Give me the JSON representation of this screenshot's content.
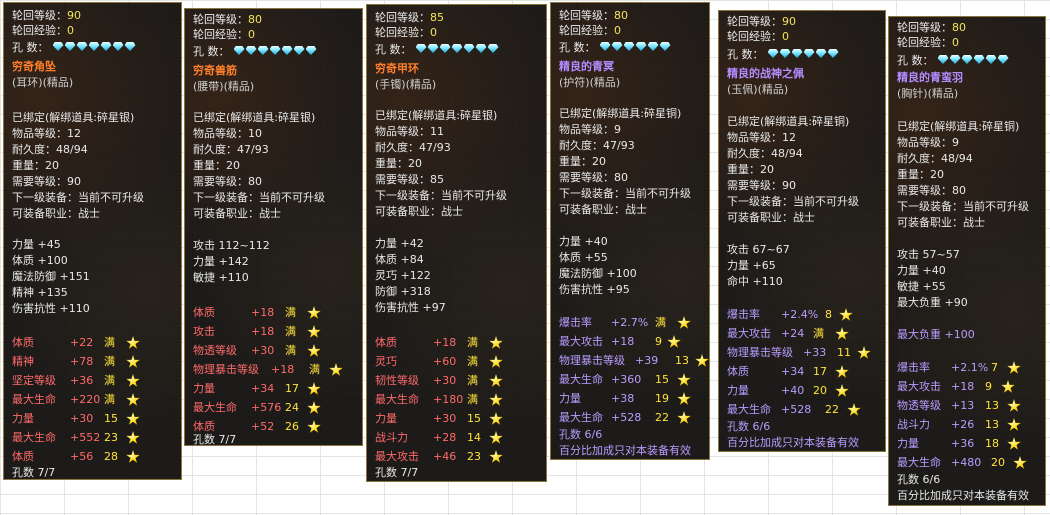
{
  "panels": [
    {
      "header": [
        {
          "label": "轮回等级：",
          "value": "90"
        },
        {
          "label": "轮回经验：",
          "value": "0"
        }
      ],
      "holes_label": "孔    数：",
      "gem_count": 7,
      "name": "穷奇角坠",
      "name_color": "#ff7f2a",
      "type": "(耳环)(精品)",
      "info": [
        "已绑定(解绑道具:碎星银)",
        "物品等级：12",
        "耐久度：48/94",
        "重量：20",
        "需要等级：90",
        "下一级装备：当前不可升级",
        "可装备职业：战士"
      ],
      "base_stats": [
        "力量 +45",
        "体质 +100",
        "魔法防御 +151",
        "精神 +135",
        "伤害抗性 +110"
      ],
      "extra_stats": [
        {
          "name": "体质",
          "value": "+22",
          "full": "满"
        },
        {
          "name": "精神",
          "value": "+78",
          "full": "满"
        },
        {
          "name": "坚定等级",
          "value": "+36",
          "full": "满"
        },
        {
          "name": "最大生命",
          "value": "+220",
          "full": "满"
        },
        {
          "name": "力量",
          "value": "+30",
          "full": "15"
        },
        {
          "name": "最大生命",
          "value": "+552",
          "full": "23"
        },
        {
          "name": "体质",
          "value": "+56",
          "full": "28"
        }
      ],
      "footer": [
        "孔数 7/7"
      ]
    },
    {
      "header": [
        {
          "label": "轮回等级：",
          "value": "80"
        },
        {
          "label": "轮回经验：",
          "value": "0"
        }
      ],
      "holes_label": "孔    数：",
      "gem_count": 7,
      "name": "穷奇兽筋",
      "name_color": "#ff7f2a",
      "type": "(腰带)(精品)",
      "info": [
        "已绑定(解绑道具:碎星银)",
        "物品等级：10",
        "耐久度：47/93",
        "重量：20",
        "需要等级：80",
        "下一级装备：当前不可升级",
        "可装备职业：战士"
      ],
      "base_stats": [
        "攻击 112~112",
        "力量 +142",
        "敏捷 +110"
      ],
      "extra_stats": [
        {
          "name": "体质",
          "value": "+18",
          "full": "满"
        },
        {
          "name": "攻击",
          "value": "+18",
          "full": "满"
        },
        {
          "name": "物透等级",
          "value": "+30",
          "full": "满"
        },
        {
          "name": "物理暴击等级",
          "value": "+18",
          "full": "满"
        },
        {
          "name": "力量",
          "value": "+34",
          "full": "17"
        },
        {
          "name": "最大生命",
          "value": "+576",
          "full": "24"
        },
        {
          "name": "体质",
          "value": "+52",
          "full": "26"
        }
      ],
      "footer": [
        "孔数 7/7"
      ]
    },
    {
      "header": [
        {
          "label": "轮回等级：",
          "value": "85"
        },
        {
          "label": "轮回经验：",
          "value": "0"
        }
      ],
      "holes_label": "孔    数：",
      "gem_count": 7,
      "name": "穷奇甲环",
      "name_color": "#ff7f2a",
      "type": "(手镯)(精品)",
      "info": [
        "已绑定(解绑道具:碎星银)",
        "物品等级：11",
        "耐久度：47/93",
        "重量：20",
        "需要等级：85",
        "下一级装备：当前不可升级",
        "可装备职业：战士"
      ],
      "base_stats": [
        "力量 +42",
        "体质 +84",
        "灵巧 +122",
        "防御 +318",
        "伤害抗性 +97"
      ],
      "extra_stats": [
        {
          "name": "体质",
          "value": "+18",
          "full": "满"
        },
        {
          "name": "灵巧",
          "value": "+60",
          "full": "满"
        },
        {
          "name": "韧性等级",
          "value": "+30",
          "full": "满"
        },
        {
          "name": "最大生命",
          "value": "+180",
          "full": "满"
        },
        {
          "name": "力量",
          "value": "+30",
          "full": "15"
        },
        {
          "name": "战斗力",
          "value": "+28",
          "full": "14"
        },
        {
          "name": "最大攻击",
          "value": "+46",
          "full": "23"
        }
      ],
      "footer": [
        "孔数 7/7"
      ]
    },
    {
      "header": [
        {
          "label": "轮回等级：",
          "value": "80"
        },
        {
          "label": "轮回经验：",
          "value": "0"
        }
      ],
      "holes_label": "孔    数：",
      "gem_count": 6,
      "name": "精良的青冥",
      "name_color": "#b48cff",
      "type": "(护符)(精品)",
      "info": [
        "已绑定(解绑道具:碎星铜)",
        "物品等级：9",
        "耐久度：47/93",
        "重量：20",
        "需要等级：80",
        "下一级装备：当前不可升级",
        "可装备职业：战士"
      ],
      "base_stats": [
        "力量 +40",
        "体质 +55",
        "魔法防御 +100",
        "伤害抗性 +95"
      ],
      "extra_stats": [
        {
          "name": "爆击率",
          "value": "+2.7%",
          "full": "满"
        },
        {
          "name": "最大攻击",
          "value": "+18",
          "full": "9"
        },
        {
          "name": "物理暴击等级",
          "value": "+39",
          "full": "13"
        },
        {
          "name": "最大生命",
          "value": "+360",
          "full": "15"
        },
        {
          "name": "力量",
          "value": "+38",
          "full": "19"
        },
        {
          "name": "最大生命",
          "value": "+528",
          "full": "22"
        }
      ],
      "footer": [
        "孔数 6/6",
        "百分比加成只对本装备有效"
      ]
    },
    {
      "header": [
        {
          "label": "轮回等级：",
          "value": "90"
        },
        {
          "label": "轮回经验：",
          "value": "0"
        }
      ],
      "holes_label": "孔    数：",
      "gem_count": 6,
      "name": "精良的战神之佩",
      "name_color": "#b48cff",
      "type": "(玉佩)(精品)",
      "info": [
        "已绑定(解绑道具:碎星铜)",
        "物品等级：12",
        "耐久度：48/94",
        "重量：20",
        "需要等级：90",
        "下一级装备：当前不可升级",
        "可装备职业：战士"
      ],
      "base_stats": [
        "攻击 67~67",
        "力量 +65",
        "命中 +110"
      ],
      "extra_stats": [
        {
          "name": "爆击率",
          "value": "+2.4%",
          "full": "8"
        },
        {
          "name": "最大攻击",
          "value": "+24",
          "full": "满"
        },
        {
          "name": "物理暴击等级",
          "value": "+33",
          "full": "11"
        },
        {
          "name": "体质",
          "value": "+34",
          "full": "17"
        },
        {
          "name": "力量",
          "value": "+40",
          "full": "20"
        },
        {
          "name": "最大生命",
          "value": "+528",
          "full": "22"
        }
      ],
      "footer": [
        "孔数 6/6",
        "百分比加成只对本装备有效"
      ]
    },
    {
      "header": [
        {
          "label": "轮回等级：",
          "value": "80"
        },
        {
          "label": "轮回经验：",
          "value": "0"
        }
      ],
      "holes_label": "孔    数：",
      "gem_count": 6,
      "name": "精良的青蛮羽",
      "name_color": "#b48cff",
      "type": "(胸针)(精品)",
      "info": [
        "已绑定(解绑道具:碎星铜)",
        "物品等级：9",
        "耐久度：48/94",
        "重量：20",
        "需要等级：80",
        "下一级装备：当前不可升级",
        "可装备职业：战士"
      ],
      "base_stats": [
        "攻击 57~57",
        "力量 +40",
        "敏捷 +55",
        "最大负重 +90"
      ],
      "extra_stats_header": {
        "name": "最大负重",
        "value": "+100"
      },
      "extra_stats": [
        {
          "name": "爆击率",
          "value": "+2.1%",
          "full": "7"
        },
        {
          "name": "最大攻击",
          "value": "+18",
          "full": "9"
        },
        {
          "name": "物透等级",
          "value": "+13",
          "full": "13"
        },
        {
          "name": "战斗力",
          "value": "+26",
          "full": "13"
        },
        {
          "name": "力量",
          "value": "+36",
          "full": "18"
        },
        {
          "name": "最大生命",
          "value": "+480",
          "full": "20"
        }
      ],
      "footer": [
        "孔数 6/6",
        "百分比加成只对本装备有效"
      ]
    }
  ],
  "colors": {
    "orange_name": "#ff7f2a",
    "purple_name": "#b48cff",
    "red_stat": "#ff6a6a",
    "purple_stat": "#b89cff",
    "header_value": "#f4e25a",
    "full_text": "#ffe33a"
  }
}
